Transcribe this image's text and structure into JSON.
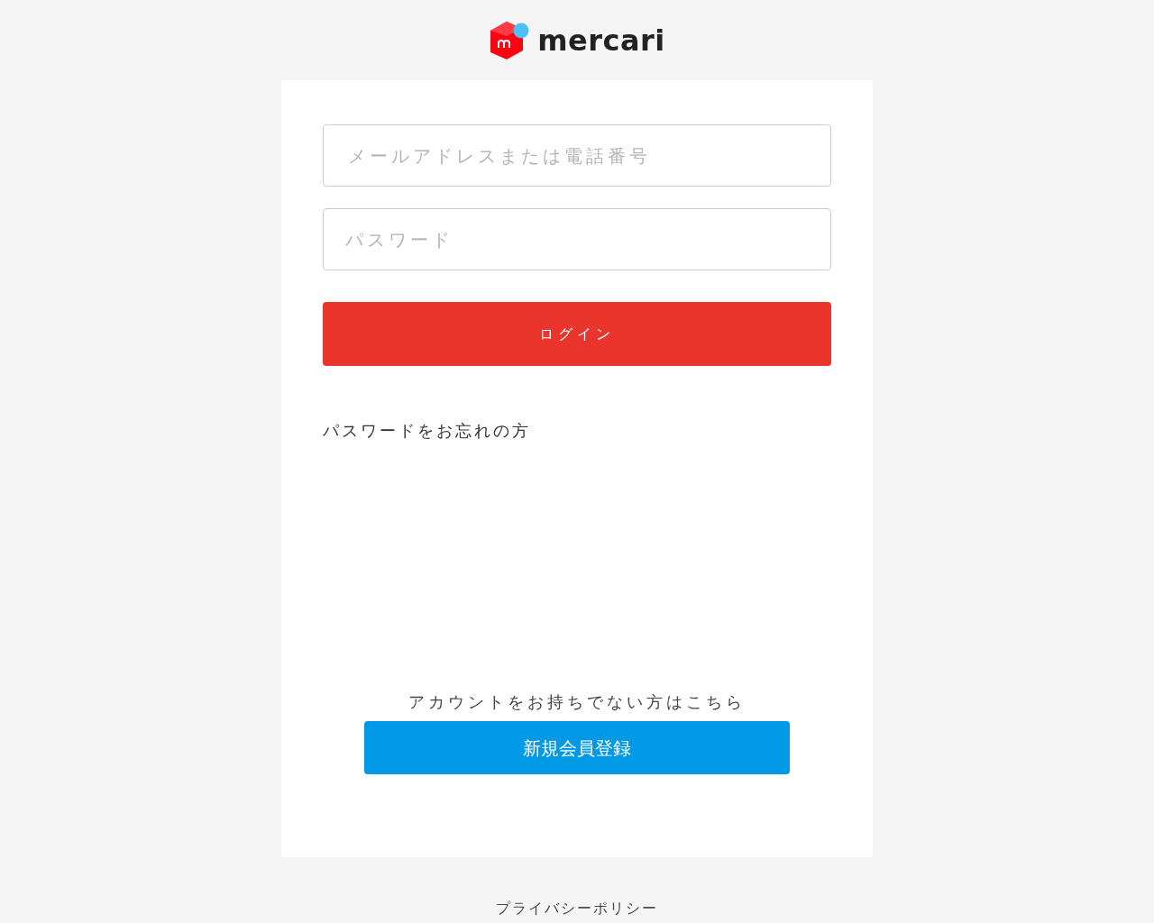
{
  "logo": {
    "text": "mercari"
  },
  "login_form": {
    "email_field": {
      "placeholder": "メールアドレスまたは電話番号"
    },
    "password_field": {
      "placeholder": "パスワード"
    },
    "login_button": "ログイン",
    "forgot_password_link": "パスワードをお忘れの方"
  },
  "signup": {
    "prompt": "アカウントをお持ちでない方はこちら",
    "button": "新規会員登録"
  },
  "footer": {
    "privacy_link": "プライバシーポリシー"
  }
}
